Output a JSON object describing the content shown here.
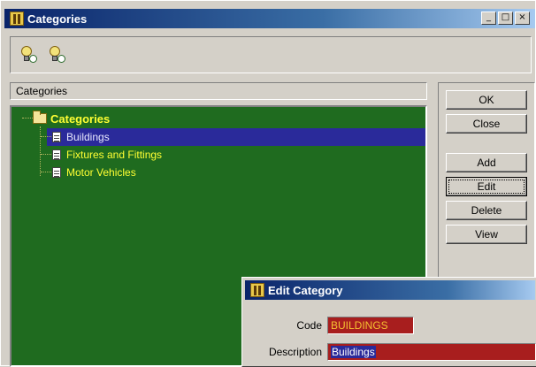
{
  "window": {
    "title": "Categories",
    "controls": [
      "_",
      "□",
      "×"
    ]
  },
  "toolbar": {
    "icons": [
      "category-icon",
      "subcategory-icon"
    ]
  },
  "path_field": {
    "value": "Categories"
  },
  "tree": {
    "root": {
      "label": "Categories"
    },
    "children": [
      {
        "label": "Buildings"
      },
      {
        "label": "Fixtures and Fittings"
      },
      {
        "label": "Motor Vehicles"
      }
    ],
    "colors": {
      "background": "#1f6b1f",
      "text": "#ffff33",
      "selection": "#2a2a9a"
    }
  },
  "buttons": {
    "ok": "OK",
    "close": "Close",
    "add": "Add",
    "edit": "Edit",
    "delete": "Delete",
    "view": "View"
  },
  "dialog": {
    "title": "Edit Category",
    "code_label": "Code",
    "code_value": "BUILDINGS",
    "description_label": "Description",
    "description_value": "Buildings"
  }
}
